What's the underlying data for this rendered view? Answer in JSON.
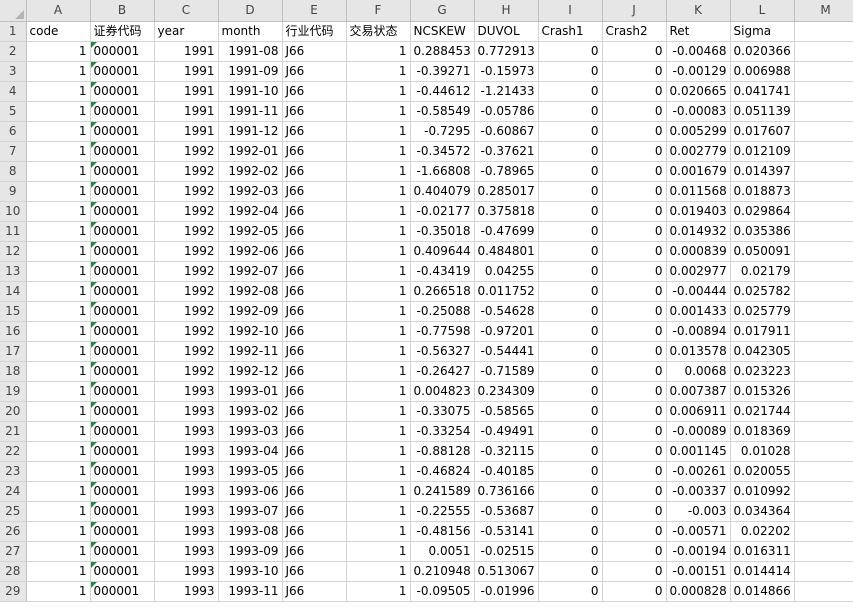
{
  "sheet": {
    "columns": [
      "A",
      "B",
      "C",
      "D",
      "E",
      "F",
      "G",
      "H",
      "I",
      "J",
      "K",
      "L",
      "M"
    ],
    "header_row": [
      "code",
      "证券代码",
      "year",
      "month",
      "行业代码",
      "交易状态",
      "NCSKEW",
      "DUVOL",
      "Crash1",
      "Crash2",
      "Ret",
      "Sigma",
      ""
    ],
    "rows": [
      {
        "n": "2",
        "cells": [
          "1",
          "000001",
          "1991",
          "1991-08",
          "J66",
          "1",
          "0.288453",
          "0.772913",
          "0",
          "0",
          "-0.00468",
          "0.020366"
        ]
      },
      {
        "n": "3",
        "cells": [
          "1",
          "000001",
          "1991",
          "1991-09",
          "J66",
          "1",
          "-0.39271",
          "-0.15973",
          "0",
          "0",
          "-0.00129",
          "0.006988"
        ]
      },
      {
        "n": "4",
        "cells": [
          "1",
          "000001",
          "1991",
          "1991-10",
          "J66",
          "1",
          "-0.44612",
          "-1.21433",
          "0",
          "0",
          "0.020665",
          "0.041741"
        ]
      },
      {
        "n": "5",
        "cells": [
          "1",
          "000001",
          "1991",
          "1991-11",
          "J66",
          "1",
          "-0.58549",
          "-0.05786",
          "0",
          "0",
          "-0.00083",
          "0.051139"
        ]
      },
      {
        "n": "6",
        "cells": [
          "1",
          "000001",
          "1991",
          "1991-12",
          "J66",
          "1",
          "-0.7295",
          "-0.60867",
          "0",
          "0",
          "0.005299",
          "0.017607"
        ]
      },
      {
        "n": "7",
        "cells": [
          "1",
          "000001",
          "1992",
          "1992-01",
          "J66",
          "1",
          "-0.34572",
          "-0.37621",
          "0",
          "0",
          "0.002779",
          "0.012109"
        ]
      },
      {
        "n": "8",
        "cells": [
          "1",
          "000001",
          "1992",
          "1992-02",
          "J66",
          "1",
          "-1.66808",
          "-0.78965",
          "0",
          "0",
          "0.001679",
          "0.014397"
        ]
      },
      {
        "n": "9",
        "cells": [
          "1",
          "000001",
          "1992",
          "1992-03",
          "J66",
          "1",
          "0.404079",
          "0.285017",
          "0",
          "0",
          "0.011568",
          "0.018873"
        ]
      },
      {
        "n": "10",
        "cells": [
          "1",
          "000001",
          "1992",
          "1992-04",
          "J66",
          "1",
          "-0.02177",
          "0.375818",
          "0",
          "0",
          "0.019403",
          "0.029864"
        ]
      },
      {
        "n": "11",
        "cells": [
          "1",
          "000001",
          "1992",
          "1992-05",
          "J66",
          "1",
          "-0.35018",
          "-0.47699",
          "0",
          "0",
          "0.014932",
          "0.035386"
        ]
      },
      {
        "n": "12",
        "cells": [
          "1",
          "000001",
          "1992",
          "1992-06",
          "J66",
          "1",
          "0.409644",
          "0.484801",
          "0",
          "0",
          "0.000839",
          "0.050091"
        ]
      },
      {
        "n": "13",
        "cells": [
          "1",
          "000001",
          "1992",
          "1992-07",
          "J66",
          "1",
          "-0.43419",
          "0.04255",
          "0",
          "0",
          "0.002977",
          "0.02179"
        ]
      },
      {
        "n": "14",
        "cells": [
          "1",
          "000001",
          "1992",
          "1992-08",
          "J66",
          "1",
          "0.266518",
          "0.011752",
          "0",
          "0",
          "-0.00444",
          "0.025782"
        ]
      },
      {
        "n": "15",
        "cells": [
          "1",
          "000001",
          "1992",
          "1992-09",
          "J66",
          "1",
          "-0.25088",
          "-0.54628",
          "0",
          "0",
          "0.001433",
          "0.025779"
        ]
      },
      {
        "n": "16",
        "cells": [
          "1",
          "000001",
          "1992",
          "1992-10",
          "J66",
          "1",
          "-0.77598",
          "-0.97201",
          "0",
          "0",
          "-0.00894",
          "0.017911"
        ]
      },
      {
        "n": "17",
        "cells": [
          "1",
          "000001",
          "1992",
          "1992-11",
          "J66",
          "1",
          "-0.56327",
          "-0.54441",
          "0",
          "0",
          "0.013578",
          "0.042305"
        ]
      },
      {
        "n": "18",
        "cells": [
          "1",
          "000001",
          "1992",
          "1992-12",
          "J66",
          "1",
          "-0.26427",
          "-0.71589",
          "0",
          "0",
          "0.0068",
          "0.023223"
        ]
      },
      {
        "n": "19",
        "cells": [
          "1",
          "000001",
          "1993",
          "1993-01",
          "J66",
          "1",
          "0.004823",
          "0.234309",
          "0",
          "0",
          "0.007387",
          "0.015326"
        ]
      },
      {
        "n": "20",
        "cells": [
          "1",
          "000001",
          "1993",
          "1993-02",
          "J66",
          "1",
          "-0.33075",
          "-0.58565",
          "0",
          "0",
          "0.006911",
          "0.021744"
        ]
      },
      {
        "n": "21",
        "cells": [
          "1",
          "000001",
          "1993",
          "1993-03",
          "J66",
          "1",
          "-0.33254",
          "-0.49491",
          "0",
          "0",
          "-0.00089",
          "0.018369"
        ]
      },
      {
        "n": "22",
        "cells": [
          "1",
          "000001",
          "1993",
          "1993-04",
          "J66",
          "1",
          "-0.88128",
          "-0.32115",
          "0",
          "0",
          "0.001145",
          "0.01028"
        ]
      },
      {
        "n": "23",
        "cells": [
          "1",
          "000001",
          "1993",
          "1993-05",
          "J66",
          "1",
          "-0.46824",
          "-0.40185",
          "0",
          "0",
          "-0.00261",
          "0.020055"
        ]
      },
      {
        "n": "24",
        "cells": [
          "1",
          "000001",
          "1993",
          "1993-06",
          "J66",
          "1",
          "0.241589",
          "0.736166",
          "0",
          "0",
          "-0.00337",
          "0.010992"
        ]
      },
      {
        "n": "25",
        "cells": [
          "1",
          "000001",
          "1993",
          "1993-07",
          "J66",
          "1",
          "-0.22555",
          "-0.53687",
          "0",
          "0",
          "-0.003",
          "0.034364"
        ]
      },
      {
        "n": "26",
        "cells": [
          "1",
          "000001",
          "1993",
          "1993-08",
          "J66",
          "1",
          "-0.48156",
          "-0.53141",
          "0",
          "0",
          "-0.00571",
          "0.02202"
        ]
      },
      {
        "n": "27",
        "cells": [
          "1",
          "000001",
          "1993",
          "1993-09",
          "J66",
          "1",
          "0.0051",
          "-0.02515",
          "0",
          "0",
          "-0.00194",
          "0.016311"
        ]
      },
      {
        "n": "28",
        "cells": [
          "1",
          "000001",
          "1993",
          "1993-10",
          "J66",
          "1",
          "0.210948",
          "0.513067",
          "0",
          "0",
          "-0.00151",
          "0.014414"
        ]
      },
      {
        "n": "29",
        "cells": [
          "1",
          "000001",
          "1993",
          "1993-11",
          "J66",
          "1",
          "-0.09505",
          "-0.01996",
          "0",
          "0",
          "0.000828",
          "0.014866"
        ]
      }
    ]
  },
  "colors": {
    "header_bg": "#e6e6e6",
    "gridline": "#d4d4d4",
    "text_marker": "#1e8c3c"
  }
}
